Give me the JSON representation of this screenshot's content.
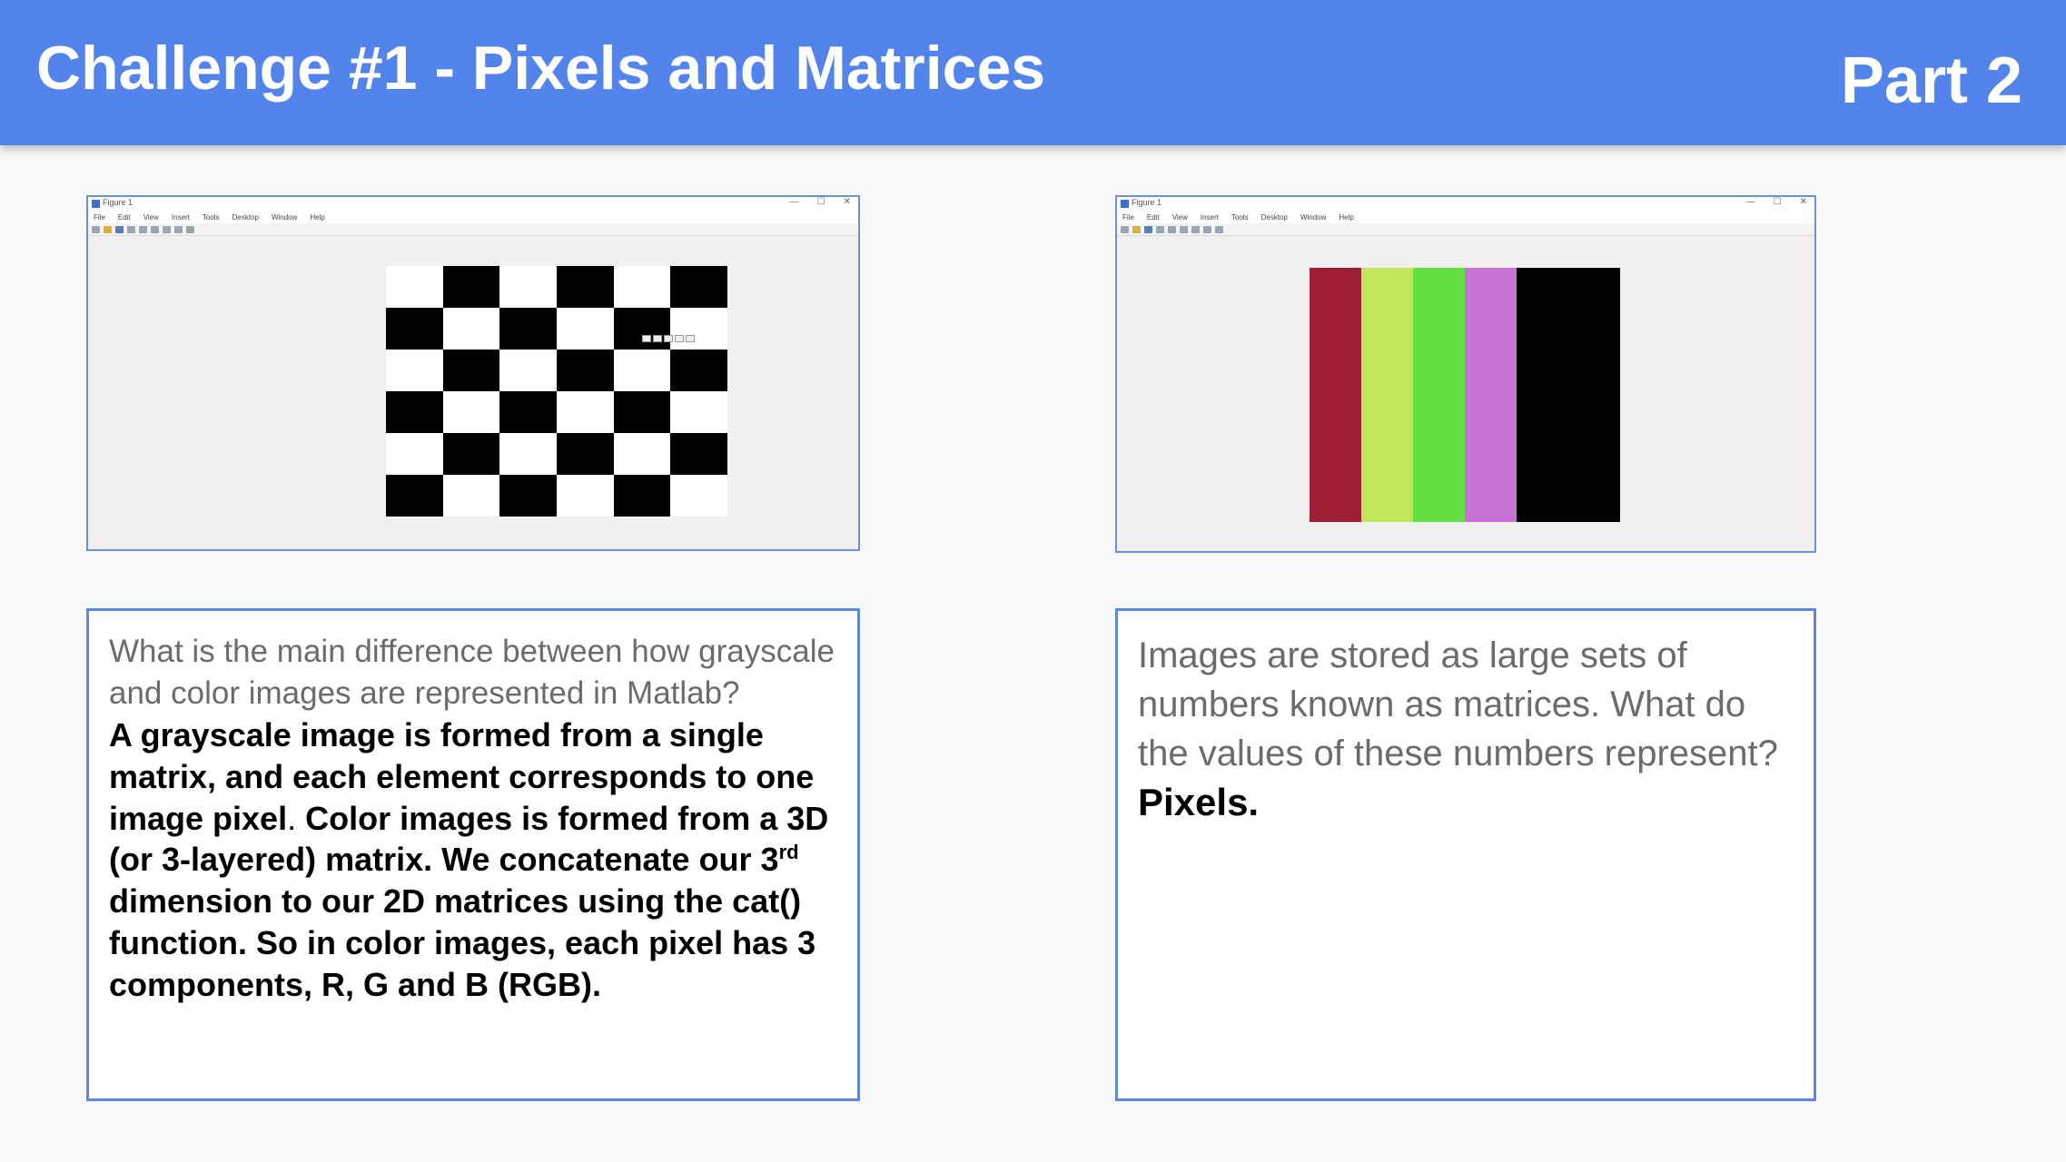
{
  "header": {
    "title": "Challenge #1 - Pixels and Matrices",
    "part": "Part 2",
    "bg_color": "#5384ec"
  },
  "figure_window": {
    "title": "Figure 1",
    "menu": [
      "File",
      "Edit",
      "View",
      "Insert",
      "Tools",
      "Desktop",
      "Window",
      "Help"
    ],
    "controls": [
      "—",
      "☐",
      "✕"
    ]
  },
  "figure_left": {
    "content": "checkerboard",
    "grid": [
      [
        "w",
        "b",
        "w",
        "b",
        "w",
        "b"
      ],
      [
        "b",
        "w",
        "b",
        "w",
        "b",
        "w"
      ],
      [
        "w",
        "b",
        "w",
        "b",
        "w",
        "b"
      ],
      [
        "b",
        "w",
        "b",
        "w",
        "b",
        "w"
      ],
      [
        "w",
        "b",
        "w",
        "b",
        "w",
        "b"
      ],
      [
        "b",
        "w",
        "b",
        "w",
        "b",
        "w"
      ]
    ]
  },
  "figure_right": {
    "content": "color-bars",
    "bar_colors": [
      "#a01f37",
      "#c1e55b",
      "#64e043",
      "#c772d4",
      "#000000",
      "#000000"
    ]
  },
  "box_left": {
    "question": "What is the main difference between how grayscale and color images are represented in Matlab?",
    "answer_part1": "A grayscale image is formed from a single matrix, and each element corresponds to one image pixel",
    "answer_period": ".",
    "answer_part2": " Color images is formed from a 3D (or 3-layered) matrix. We concatenate our 3",
    "answer_sup": "rd",
    "answer_part3": " dimension to our 2D matrices using the cat() function. So in color images, each pixel has 3 components, R, G and B (RGB)."
  },
  "box_right": {
    "question": "Images are stored as large sets of numbers known as matrices. What do the values of these numbers represent?",
    "answer": "Pixels."
  },
  "colors": {
    "accent": "#5384ec",
    "box_border": "#5b86e5",
    "question_text": "#6b6b6b"
  }
}
